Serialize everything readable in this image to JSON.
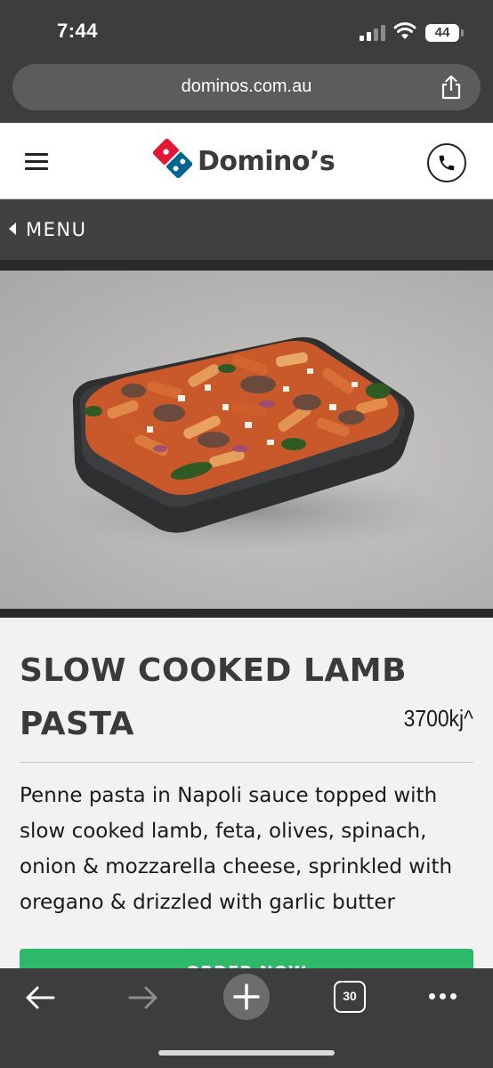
{
  "status_bar": {
    "time": "7:44",
    "battery": "44"
  },
  "browser": {
    "url": "dominos.com.au",
    "tab_count": "30"
  },
  "header": {
    "brand": "Domino’s",
    "brand_colors": {
      "red": "#e31837",
      "blue": "#006491"
    }
  },
  "nav": {
    "back_label": "MENU"
  },
  "product": {
    "name": "SLOW COOKED LAMB PASTA",
    "energy": "3700kj^",
    "description": "Penne pasta in Napoli sauce topped with slow cooked lamb, feta, olives, spinach, onion & mozzarella cheese, sprinkled with oregano & drizzled with garlic butter",
    "order_button": "ORDER NOW",
    "button_color": "#2db86a"
  },
  "icons": {
    "share": "share-icon",
    "menu": "hamburger-icon",
    "phone": "phone-icon",
    "back": "arrow-left-icon",
    "forward": "arrow-right-icon",
    "new_tab": "plus-icon",
    "more": "more-icon"
  }
}
